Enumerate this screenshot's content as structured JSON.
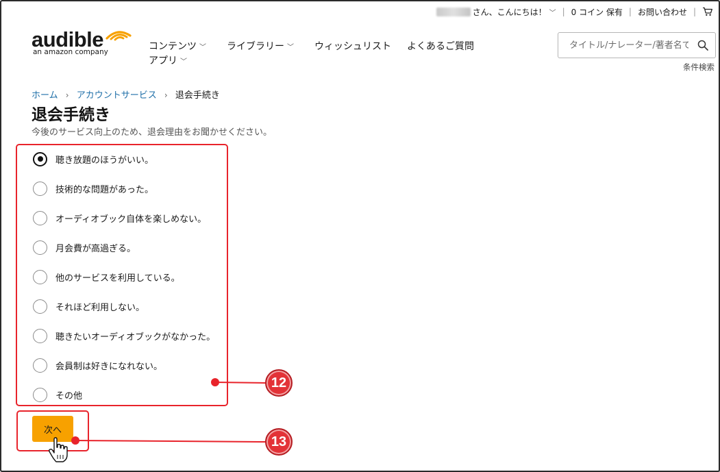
{
  "header": {
    "greeting": "さん、こんにちは！",
    "coins": "0 コイン 保有",
    "contact": "お問い合わせ"
  },
  "logo": {
    "word": "audible",
    "sub": "an amazon company"
  },
  "nav": {
    "items": [
      "コンテンツ",
      "ライブラリー",
      "ウィッシュリスト",
      "よくあるご質問",
      "アプリ"
    ]
  },
  "search": {
    "placeholder": "タイトル/ナレーター/著者名で",
    "advanced": "条件検索"
  },
  "breadcrumb": {
    "home": "ホーム",
    "account": "アカウントサービス",
    "current": "退会手続き"
  },
  "page": {
    "title": "退会手続き",
    "subtitle": "今後のサービス向上のため、退会理由をお聞かせください。"
  },
  "reasons": {
    "selected_index": 0,
    "items": [
      "聴き放題のほうがいい。",
      "技術的な問題があった。",
      "オーディオブック自体を楽しめない。",
      "月会費が高過ぎる。",
      "他のサービスを利用している。",
      "それほど利用しない。",
      "聴きたいオーディオブックがなかった。",
      "会員制は好きになれない。",
      "その他"
    ]
  },
  "next_button": {
    "label": "次へ"
  },
  "annotations": {
    "badge_12": "12",
    "badge_13": "13",
    "color": "#e8232b"
  },
  "colors": {
    "accent": "#f7a100",
    "link": "#1f6fa8",
    "logo_orange": "#f7a100"
  }
}
